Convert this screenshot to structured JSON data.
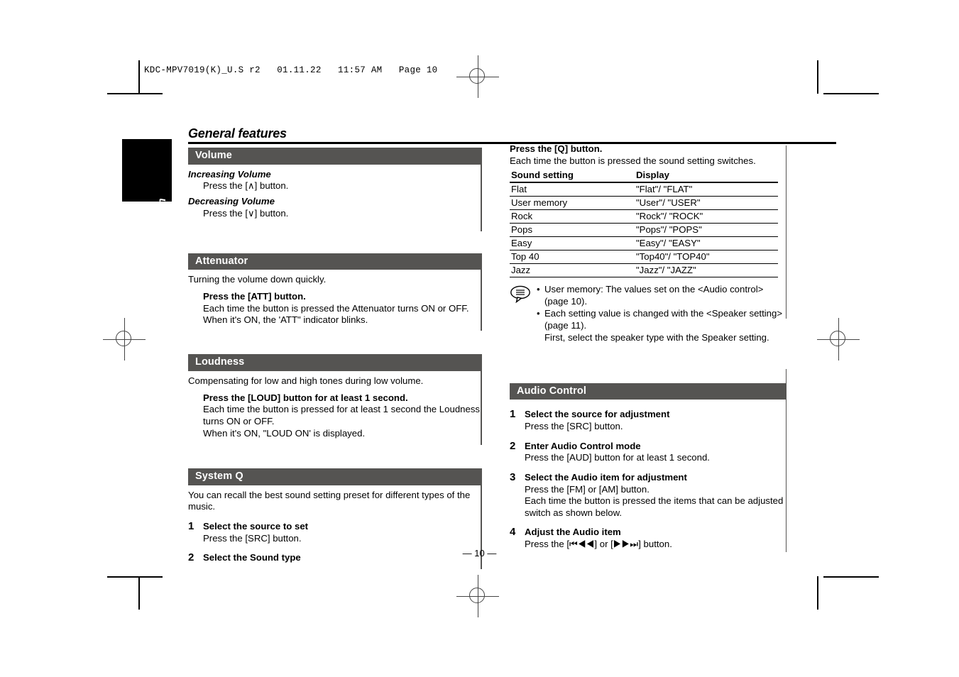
{
  "file_header": "KDC-MPV7019(K)_U.S r2   01.11.22   11:57 AM   Page 10",
  "language_tab": "English",
  "page_title": "General features",
  "page_number": "— 10 —",
  "colors": {
    "section_header_bg": "#555452",
    "section_header_text": "#ffffff",
    "language_tab_bg": "#000000",
    "rule": "#000000"
  },
  "left_column": {
    "sections": [
      {
        "id": "volume",
        "title": "Volume",
        "blocks": [
          {
            "kind": "bold-italic",
            "text": "Increasing Volume"
          },
          {
            "kind": "indent",
            "text": "Press the [∧] button."
          },
          {
            "kind": "bold-italic",
            "text": "Decreasing Volume"
          },
          {
            "kind": "indent",
            "text": "Press the [∨] button."
          }
        ]
      },
      {
        "id": "attenuator",
        "title": "Attenuator",
        "blocks": [
          {
            "kind": "plain",
            "text": "Turning the volume down quickly."
          },
          {
            "kind": "indent-bold",
            "text": "Press the [ATT] button."
          },
          {
            "kind": "indent",
            "text": "Each time the button is pressed the Attenuator turns ON or OFF. When it's ON, the 'ATT\" indicator blinks."
          }
        ]
      },
      {
        "id": "loudness",
        "title": "Loudness",
        "blocks": [
          {
            "kind": "plain",
            "text": "Compensating for low and high tones during low volume."
          },
          {
            "kind": "indent-bold",
            "text": "Press the [LOUD] button for at least 1 second."
          },
          {
            "kind": "indent",
            "text": "Each time the button is pressed for at least 1 second the Loudness turns ON or OFF."
          },
          {
            "kind": "indent",
            "text": "When it's ON, \"LOUD ON' is displayed."
          }
        ]
      },
      {
        "id": "system-q",
        "title": "System Q",
        "blocks": [
          {
            "kind": "plain",
            "text": "You can recall the best sound setting preset for different types of the music."
          }
        ],
        "steps": [
          {
            "num": "1",
            "title": "Select the source to set",
            "lines": [
              "Press the [SRC] button."
            ]
          },
          {
            "num": "2",
            "title": "Select the Sound type",
            "lines": []
          }
        ]
      }
    ]
  },
  "right_column": {
    "intro": {
      "bold_line": "Press the [Q] button.",
      "line": "Each time the button is pressed the sound setting switches."
    },
    "table": {
      "headers": [
        "Sound setting",
        "Display"
      ],
      "rows": [
        [
          "Flat",
          "\"Flat\"/ \"FLAT\""
        ],
        [
          "User memory",
          "\"User\"/ \"USER\""
        ],
        [
          "Rock",
          "\"Rock\"/ \"ROCK\""
        ],
        [
          "Pops",
          "\"Pops\"/ \"POPS\""
        ],
        [
          "Easy",
          "\"Easy\"/ \"EASY\""
        ],
        [
          "Top 40",
          "\"Top40\"/ \"TOP40\""
        ],
        [
          "Jazz",
          "\"Jazz\"/ \"JAZZ\""
        ]
      ]
    },
    "note": {
      "icon": "note-speech-bubble-icon",
      "bullets": [
        "User memory: The values set on the <Audio control> (page 10).",
        "Each setting value is changed with the <Speaker setting> (page 11)."
      ],
      "sub_line": "First, select the speaker type with the Speaker setting."
    },
    "audio_control": {
      "title": "Audio Control",
      "steps": [
        {
          "num": "1",
          "title": "Select the source for adjustment",
          "lines": [
            "Press the [SRC] button."
          ]
        },
        {
          "num": "2",
          "title": "Enter Audio Control mode",
          "lines": [
            "Press the [AUD] button for at least 1 second."
          ]
        },
        {
          "num": "3",
          "title": "Select the Audio item for adjustment",
          "lines": [
            "Press the [FM] or [AM] button.",
            "Each time the button is pressed the items that can be adjusted switch as shown below."
          ]
        },
        {
          "num": "4",
          "title": "Adjust the Audio item",
          "lines": [
            "Press the [⏮◀◀] or [▶▶⏭] button."
          ]
        }
      ]
    }
  }
}
